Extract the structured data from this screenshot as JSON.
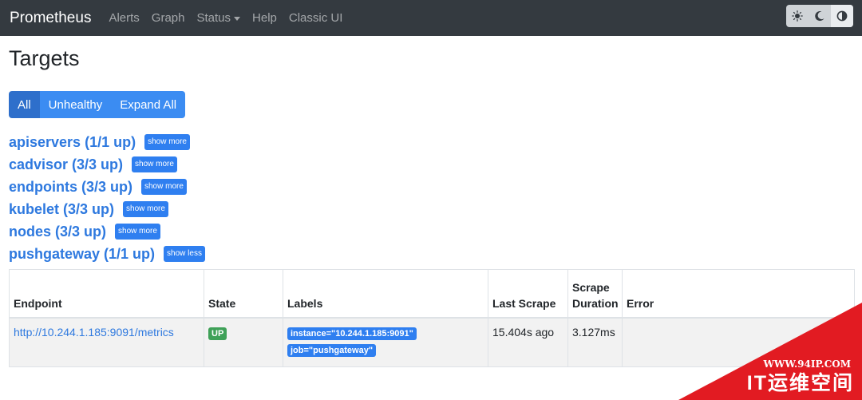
{
  "navbar": {
    "brand": "Prometheus",
    "items": [
      "Alerts",
      "Graph",
      "Status",
      "Help",
      "Classic UI"
    ],
    "theme_buttons": [
      "sun-icon",
      "moon-icon",
      "half-circle-icon"
    ]
  },
  "page": {
    "title": "Targets",
    "filters": [
      "All",
      "Unhealthy",
      "Expand All"
    ]
  },
  "jobs": [
    {
      "title": "apiservers (1/1 up)",
      "button": "show more"
    },
    {
      "title": "cadvisor (3/3 up)",
      "button": "show more"
    },
    {
      "title": "endpoints (3/3 up)",
      "button": "show more"
    },
    {
      "title": "kubelet (3/3 up)",
      "button": "show more"
    },
    {
      "title": "nodes (3/3 up)",
      "button": "show more"
    },
    {
      "title": "pushgateway (1/1 up)",
      "button": "show less"
    }
  ],
  "table": {
    "headers": {
      "endpoint": "Endpoint",
      "state": "State",
      "labels": "Labels",
      "last_scrape": "Last Scrape",
      "scrape_duration_1": "Scrape",
      "scrape_duration_2": "Duration",
      "error": "Error"
    },
    "rows": [
      {
        "endpoint": "http://10.244.1.185:9091/metrics",
        "state": "UP",
        "labels": [
          "instance=\"10.244.1.185:9091\"",
          "job=\"pushgateway\""
        ],
        "last_scrape": "15.404s ago",
        "scrape_duration": "3.127ms",
        "error": ""
      }
    ]
  },
  "watermark": {
    "url": "WWW.94IP.COM",
    "name": "IT运维空间"
  },
  "colors": {
    "navbar": "#343a40",
    "primary": "#3b8cf2",
    "link": "#2e79df",
    "success": "#3fa158",
    "watermark": "#e21b22"
  }
}
